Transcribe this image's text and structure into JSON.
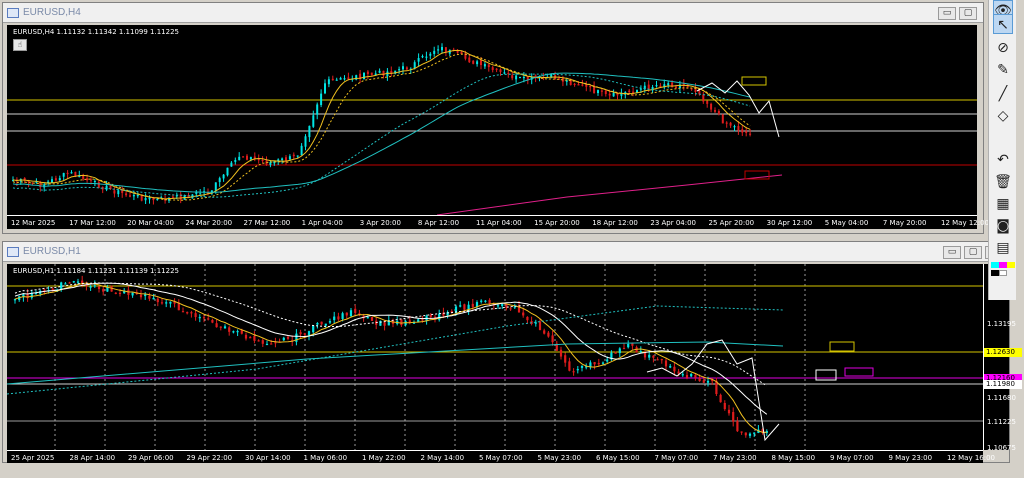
{
  "top_window": {
    "title": "EURUSD,H4",
    "info": "EURUSD,H4  1.11132 1.11342 1.11099 1.11225",
    "buttons": [
      "▭",
      "▢"
    ],
    "x_labels": [
      "12 Mar 2025",
      "17 Mar 12:00",
      "20 Mar 04:00",
      "24 Mar 20:00",
      "27 Mar 12:00",
      "1 Apr 04:00",
      "3 Apr 20:00",
      "8 Apr 12:00",
      "11 Apr 04:00",
      "15 Apr 20:00",
      "18 Apr 12:00",
      "23 Apr 04:00",
      "25 Apr 20:00",
      "30 Apr 12:00",
      "5 May 04:00",
      "7 May 20:00",
      "12 May 12:00"
    ]
  },
  "bottom_window": {
    "title": "EURUSD,H1",
    "info": "EURUSD,H1  1.11184 1.11231 1.11139 1.11225",
    "buttons": [
      "▭",
      "▢",
      "✕"
    ],
    "x_labels": [
      "25 Apr 2025",
      "28 Apr 14:00",
      "29 Apr 06:00",
      "29 Apr 22:00",
      "30 Apr 14:00",
      "1 May 06:00",
      "1 May 22:00",
      "2 May 14:00",
      "5 May 07:00",
      "5 May 23:00",
      "6 May 15:00",
      "7 May 07:00",
      "7 May 23:00",
      "8 May 15:00",
      "9 May 07:00",
      "9 May 23:00",
      "12 May 16:00"
    ],
    "y_labels": [
      "1.13195",
      "1.11680",
      "1.11225",
      "1.10675"
    ],
    "price_tags": [
      {
        "text": "1.12630",
        "bg": "#ffff00",
        "fg": "#000000"
      },
      {
        "text": "1.12160",
        "bg": "#ff00ff",
        "fg": "#000000"
      },
      {
        "text": "1.11980",
        "bg": "#ffffff",
        "fg": "#000000"
      }
    ]
  },
  "toolbar": {
    "tools": [
      "eye-icon",
      "cursor-icon",
      "crosshair-off-icon",
      "eraser-icon",
      "line-icon",
      "ruler-icon",
      "undo-icon",
      "trash-icon",
      "screenshot-icon",
      "camera-icon",
      "clipboard-icon"
    ]
  },
  "colors": {
    "bull": "#00e5e5",
    "bear": "#e01c1c",
    "ma_fast": "#f0c020",
    "ma_mid": "#ffffff",
    "ma_slow": "#20c0c0",
    "ma_pink": "#e0208a",
    "hline_yellow": "#d4c400",
    "hline_white": "#cfcfcf",
    "hline_red": "#c00000",
    "hline_magenta": "#e000e0"
  }
}
